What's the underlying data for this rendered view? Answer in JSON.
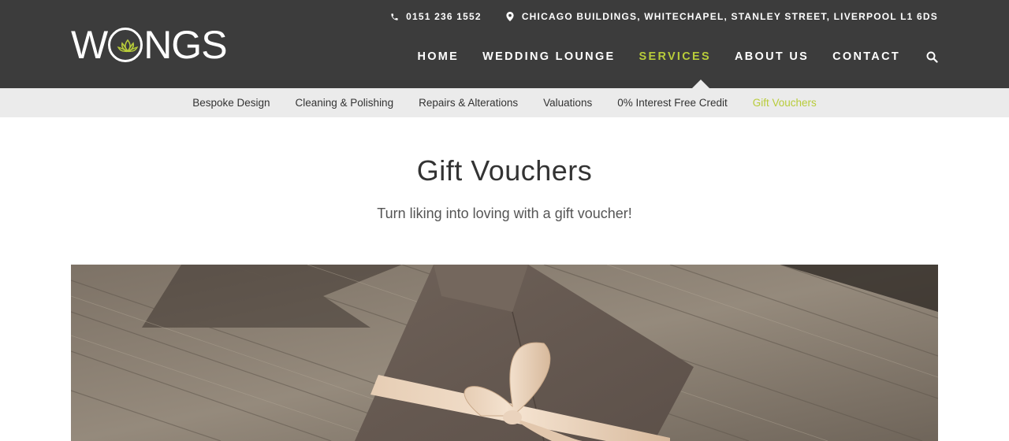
{
  "header": {
    "logo_text": "WONGS",
    "phone": "0151 236 1552",
    "address": "CHICAGO BUILDINGS, WHITECHAPEL, STANLEY STREET, LIVERPOOL L1 6DS",
    "icons": {
      "phone": "phone-icon",
      "address": "map-pin-icon",
      "search": "search-icon"
    }
  },
  "nav": {
    "items": [
      {
        "label": "HOME",
        "active": false
      },
      {
        "label": "WEDDING LOUNGE",
        "active": false
      },
      {
        "label": "SERVICES",
        "active": true
      },
      {
        "label": "ABOUT US",
        "active": false
      },
      {
        "label": "CONTACT",
        "active": false
      }
    ]
  },
  "subnav": {
    "items": [
      {
        "label": "Bespoke Design",
        "active": false
      },
      {
        "label": "Cleaning & Polishing",
        "active": false
      },
      {
        "label": "Repairs & Alterations",
        "active": false
      },
      {
        "label": "Valuations",
        "active": false
      },
      {
        "label": "0% Interest Free Credit",
        "active": false
      },
      {
        "label": "Gift Vouchers",
        "active": true
      }
    ]
  },
  "page": {
    "title": "Gift Vouchers",
    "subtitle": "Turn liking into loving with a gift voucher!"
  },
  "colors": {
    "header_bg": "#3c3c3c",
    "accent": "#b8cc3a",
    "subnav_bg": "#ebebeb"
  }
}
